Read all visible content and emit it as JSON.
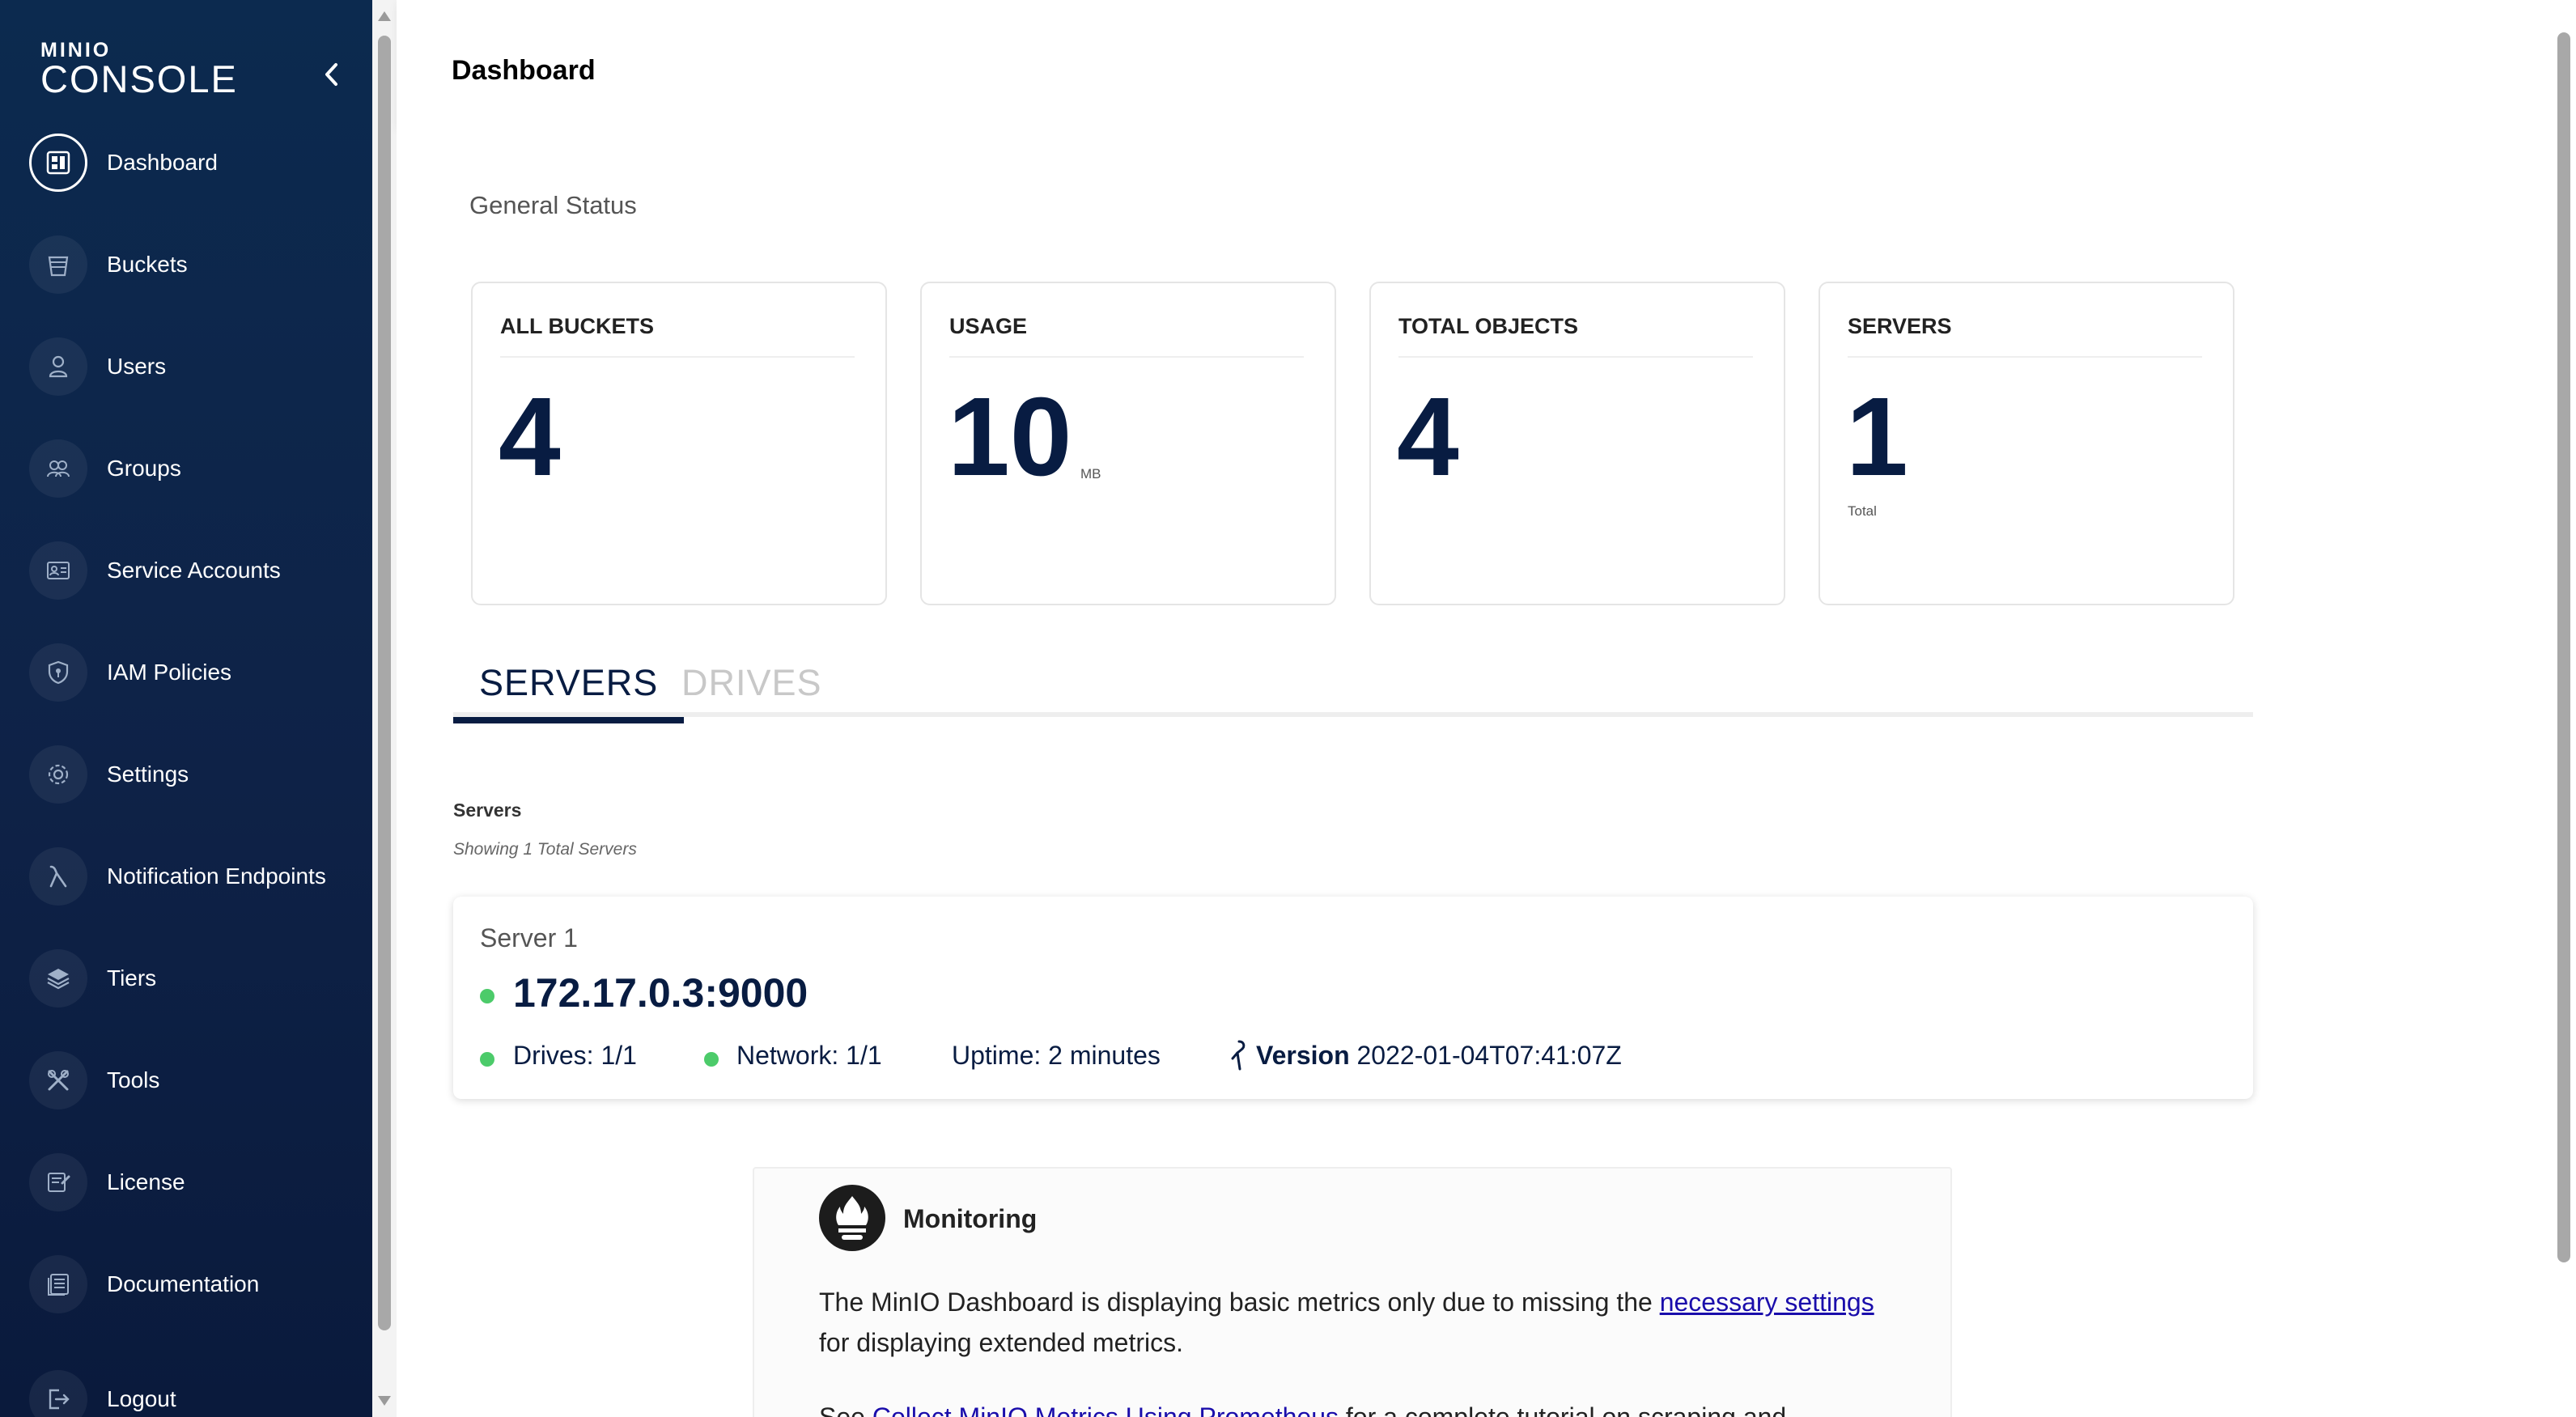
{
  "app": {
    "logo_top": "MINIO",
    "logo_bottom": "CONSOLE"
  },
  "sidebar": {
    "items": [
      {
        "label": "Dashboard",
        "icon": "dashboard-icon"
      },
      {
        "label": "Buckets",
        "icon": "bucket-icon"
      },
      {
        "label": "Users",
        "icon": "user-icon"
      },
      {
        "label": "Groups",
        "icon": "groups-icon"
      },
      {
        "label": "Service Accounts",
        "icon": "service-account-icon"
      },
      {
        "label": "IAM Policies",
        "icon": "shield-icon"
      },
      {
        "label": "Settings",
        "icon": "gear-icon"
      },
      {
        "label": "Notification Endpoints",
        "icon": "lambda-icon"
      },
      {
        "label": "Tiers",
        "icon": "layers-icon"
      },
      {
        "label": "Tools",
        "icon": "tools-icon"
      },
      {
        "label": "License",
        "icon": "license-icon"
      },
      {
        "label": "Documentation",
        "icon": "documentation-icon"
      },
      {
        "label": "Logout",
        "icon": "logout-icon"
      }
    ]
  },
  "header": {
    "title": "Dashboard"
  },
  "main": {
    "section_title": "General Status",
    "cards": [
      {
        "title": "ALL BUCKETS",
        "value": "4",
        "unit": ""
      },
      {
        "title": "USAGE",
        "value": "10",
        "unit": "MB"
      },
      {
        "title": "TOTAL OBJECTS",
        "value": "4",
        "unit": ""
      },
      {
        "title": "SERVERS",
        "value": "1",
        "unit": "Total"
      }
    ],
    "tabs": [
      {
        "label": "SERVERS"
      },
      {
        "label": "DRIVES"
      }
    ],
    "servers_label": "Servers",
    "servers_sub": "Showing 1 Total Servers",
    "server": {
      "name": "Server 1",
      "endpoint": "172.17.0.3:9000",
      "drives": "Drives: 1/1",
      "network": "Network: 1/1",
      "uptime": "Uptime: 2 minutes",
      "version_label": "Version",
      "version_value": "2022-01-04T07:41:07Z"
    },
    "monitoring": {
      "title": "Monitoring",
      "text_before": "The MinIO Dashboard is displaying basic metrics only due to missing the ",
      "link1": "necessary settings",
      "text_after": " for displaying extended metrics.",
      "text2_before": "See ",
      "link2": "Collect MinIO Metrics Using Prometheus",
      "text2_after": " for a complete tutorial on scraping and"
    }
  },
  "colors": {
    "sidebar_bg": "#0e2247",
    "accent": "#081c42",
    "status_ok": "#4ccb6a"
  }
}
